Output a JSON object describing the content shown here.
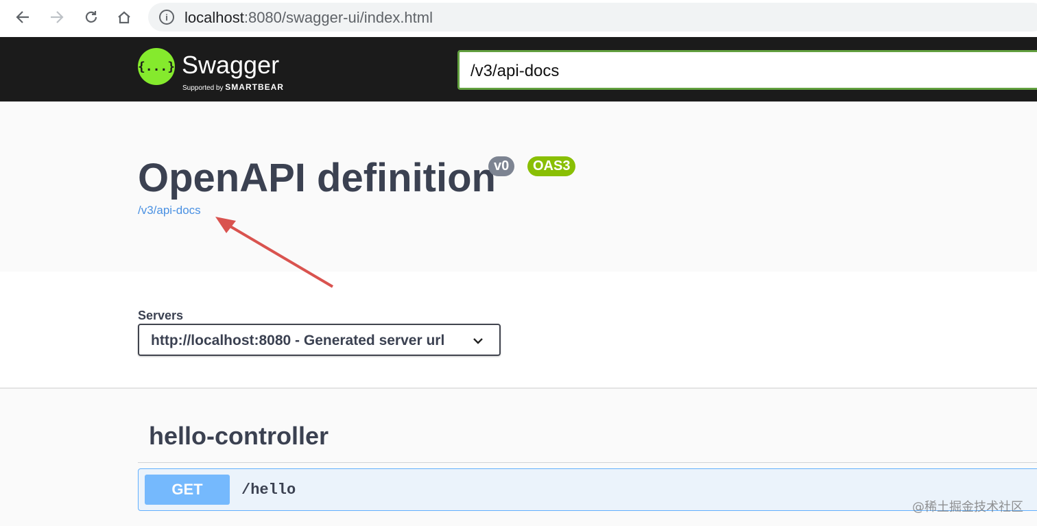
{
  "browser": {
    "url_host": "localhost",
    "url_path": ":8080/swagger-ui/index.html",
    "info_icon": "info-icon"
  },
  "topbar": {
    "logo_glyph": "{...}",
    "logo_name": "Swagger",
    "logo_supported_by": "Supported by",
    "logo_company": "SMARTBEAR",
    "spec_url_value": "/v3/api-docs"
  },
  "info": {
    "title": "OpenAPI definition",
    "version_badge": "v0",
    "oas_badge": "OAS3",
    "spec_link": "/v3/api-docs"
  },
  "servers": {
    "label": "Servers",
    "selected": "http://localhost:8080 - Generated server url"
  },
  "operations": {
    "tag": "hello-controller",
    "items": [
      {
        "method": "GET",
        "path": "/hello"
      }
    ]
  },
  "watermark": "@稀土掘金技术社区",
  "colors": {
    "topbar_bg": "#1b1b1b",
    "brand_green": "#85ea2d",
    "get_blue": "#61affe",
    "oas_green": "#89bf04",
    "annotation_red": "#d9534f"
  }
}
